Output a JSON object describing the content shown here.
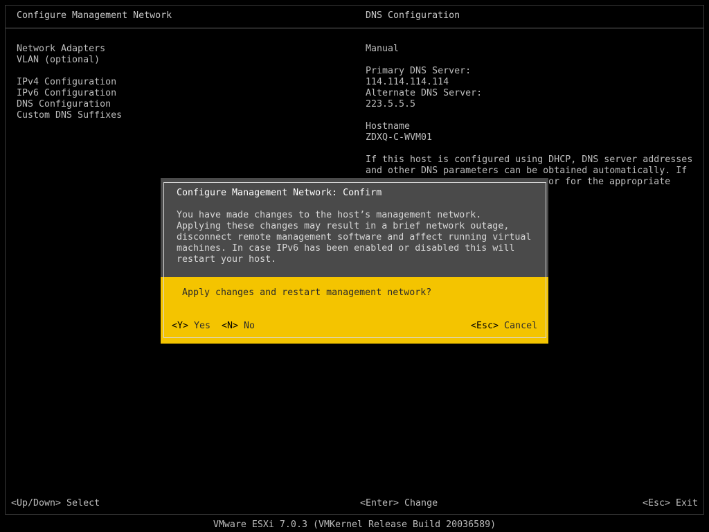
{
  "header": {
    "left_title": "Configure Management Network",
    "right_title": "DNS Configuration"
  },
  "menu": {
    "items": [
      "Network Adapters",
      "VLAN (optional)",
      "IPv4 Configuration",
      "IPv6 Configuration",
      "DNS Configuration",
      "Custom DNS Suffixes"
    ]
  },
  "details": {
    "mode": "Manual",
    "primary_dns_label": "Primary DNS Server:",
    "primary_dns_value": "114.114.114.114",
    "alternate_dns_label": "Alternate DNS Server:",
    "alternate_dns_value": "223.5.5.5",
    "hostname_label": "Hostname",
    "hostname_value": "ZDXQ-C-WVM01",
    "help_lines": [
      "If this host is configured using DHCP, DNS server addresses",
      "and other DNS parameters can be obtained automatically. If",
      "or for the appropriate"
    ]
  },
  "dialog": {
    "title": "Configure Management Network: Confirm",
    "message_lines": [
      "You have made changes to the host’s management network.",
      "Applying these changes may result in a brief network outage,",
      "disconnect remote management software and affect running virtual",
      "machines. In case IPv6 has been enabled or disabled this will",
      "restart your host."
    ],
    "question": "Apply changes and restart management network?",
    "yes_key": "<Y>",
    "yes_label": "Yes",
    "no_key": "<N>",
    "no_label": "No",
    "cancel_key": "<Esc>",
    "cancel_label": "Cancel"
  },
  "footer": {
    "left": "<Up/Down> Select",
    "center": "<Enter> Change",
    "right": "<Esc> Exit"
  },
  "status_bar": "VMware ESXi 7.0.3 (VMKernel Release Build 20036589)",
  "colors": {
    "background": "#000000",
    "dialog_accent": "#f4c400",
    "dialog_body": "#4a4a4a",
    "text": "#bdbdbd"
  }
}
